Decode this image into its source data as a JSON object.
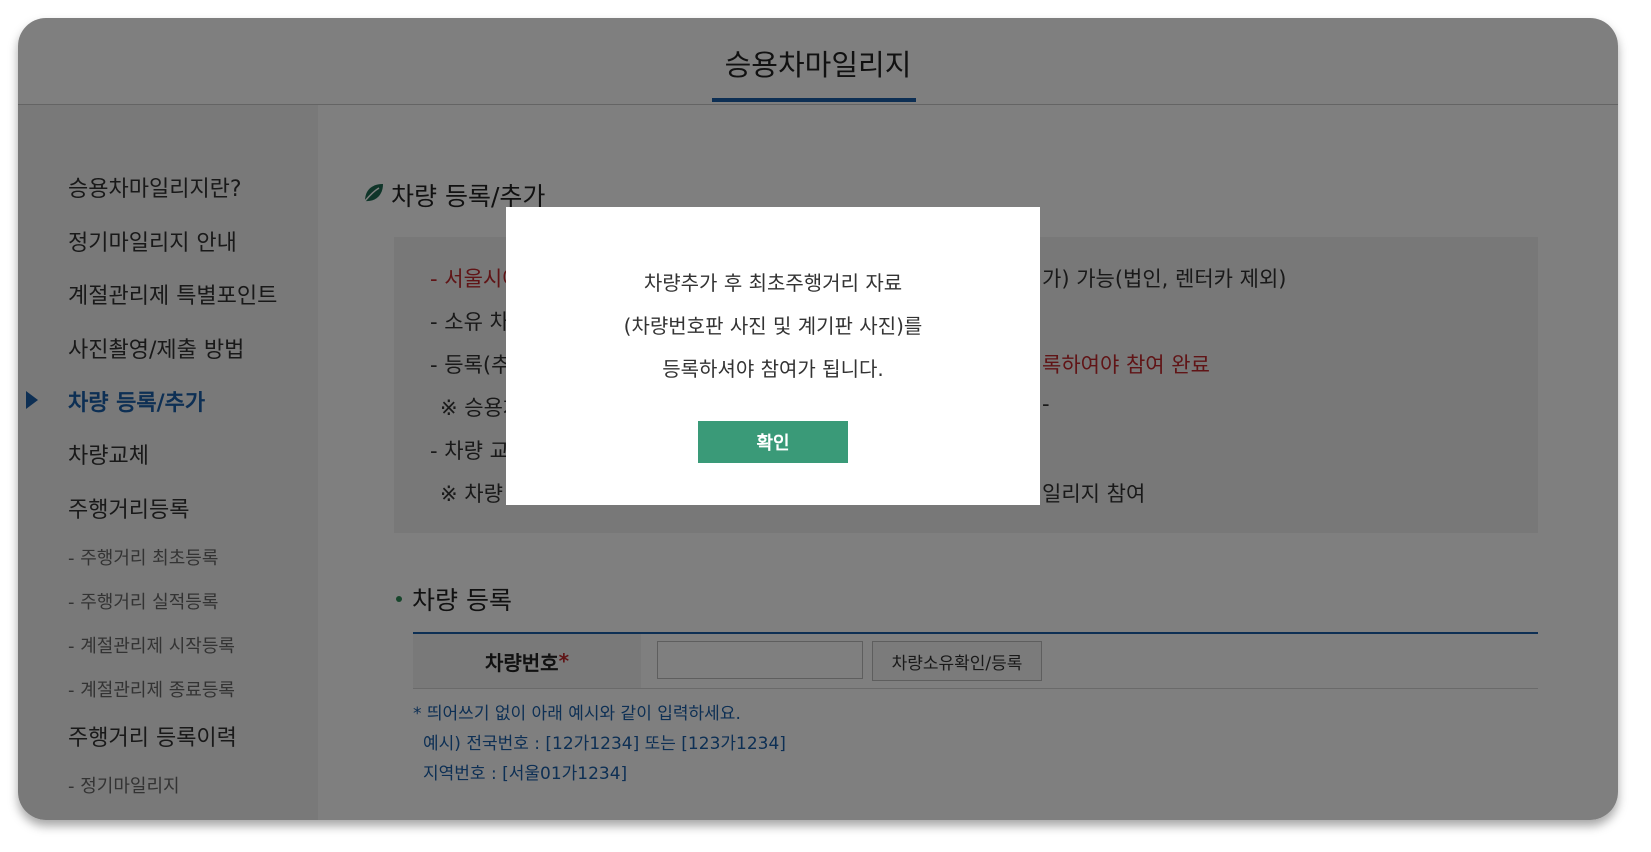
{
  "header": {
    "title": "승용차마일리지"
  },
  "sidebar": {
    "items": [
      {
        "label": "승용차마일리지란?"
      },
      {
        "label": "정기마일리지 안내"
      },
      {
        "label": "계절관리제 특별포인트"
      },
      {
        "label": "사진촬영/제출 방법"
      },
      {
        "label": "차량 등록/추가"
      },
      {
        "label": "차량교체"
      },
      {
        "label": "주행거리등록"
      },
      {
        "label": "- 주행거리 최초등록"
      },
      {
        "label": "- 주행거리 실적등록"
      },
      {
        "label": "- 계절관리제 시작등록"
      },
      {
        "label": "- 계절관리제 종료등록"
      },
      {
        "label": "주행거리 등록이력"
      },
      {
        "label": "- 정기마일리지"
      }
    ]
  },
  "main": {
    "section_title": "차량 등록/추가",
    "info": {
      "line1_red": "- 서울시에 -",
      "line1_tail": "가) 가능(법인, 렌터카 제외)",
      "line2": "- 소유 차량",
      "line3": "- 등록(추가)",
      "line3_tail_red": "록하여야 참여 완료",
      "line4": "※ 승용차마",
      "line4_tail": "-",
      "line5": "- 차량 교체",
      "line6": "※ 차량 변",
      "line6_tail": "일리지 참여"
    },
    "sub_title": "차량 등록",
    "form": {
      "label": "차량번호",
      "required_mark": "*",
      "input_value": "",
      "verify_button": "차량소유확인/등록"
    },
    "notes": [
      "* 띄어쓰기 없이 아래 예시와 같이 입력하세요.",
      "예시) 전국번호 : [12가1234] 또는 [123가1234]",
      "지역번호 : [서울01가1234]"
    ]
  },
  "modal": {
    "lines": [
      "차량추가 후 최초주행거리 자료",
      "(차량번호판 사진 및 계기판 사진)를",
      "등록하셔야 참여가 됩니다."
    ],
    "confirm_button": "확인"
  },
  "colors": {
    "accent": "#1a5fa8",
    "confirm": "#3a9a78",
    "warning": "#c0282c",
    "overlay": "rgba(0,0,0,0.5)"
  },
  "icons": {
    "section": "leaf-icon",
    "active": "triangle-right-icon"
  }
}
